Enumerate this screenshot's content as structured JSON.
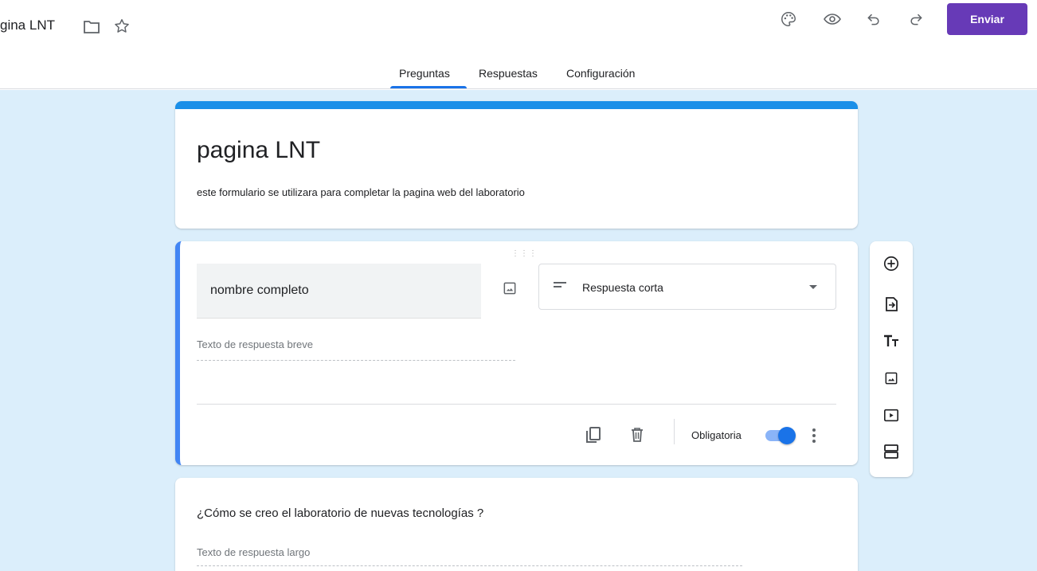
{
  "header": {
    "doc_title": "gina LNT",
    "send_label": "Enviar",
    "icons": [
      "folder-icon",
      "star-icon",
      "palette-icon",
      "preview-icon",
      "undo-icon",
      "redo-icon"
    ]
  },
  "tabs": [
    {
      "label": "Preguntas",
      "active": true
    },
    {
      "label": "Respuestas",
      "active": false
    },
    {
      "label": "Configuración",
      "active": false
    }
  ],
  "form": {
    "title": "pagina LNT",
    "description": "este formulario se utilizara para completar la pagina web del laboratorio"
  },
  "question1": {
    "title": "nombre completo",
    "type_label": "Respuesta corta",
    "answer_placeholder": "Texto de respuesta breve",
    "required_label": "Obligatoria",
    "required": true
  },
  "question2": {
    "title": "¿Cómo se creo el laboratorio de nuevas tecnologías ?",
    "answer_placeholder": "Texto de respuesta largo"
  },
  "toolbar": {
    "icons": [
      "add-question-icon",
      "import-questions-icon",
      "add-title-icon",
      "add-image-icon",
      "add-video-icon",
      "add-section-icon"
    ]
  },
  "colors": {
    "accent": "#673ab7",
    "header_bar": "#1a8fe8",
    "active_blue": "#1a73e8",
    "background": "#dbeefb"
  }
}
